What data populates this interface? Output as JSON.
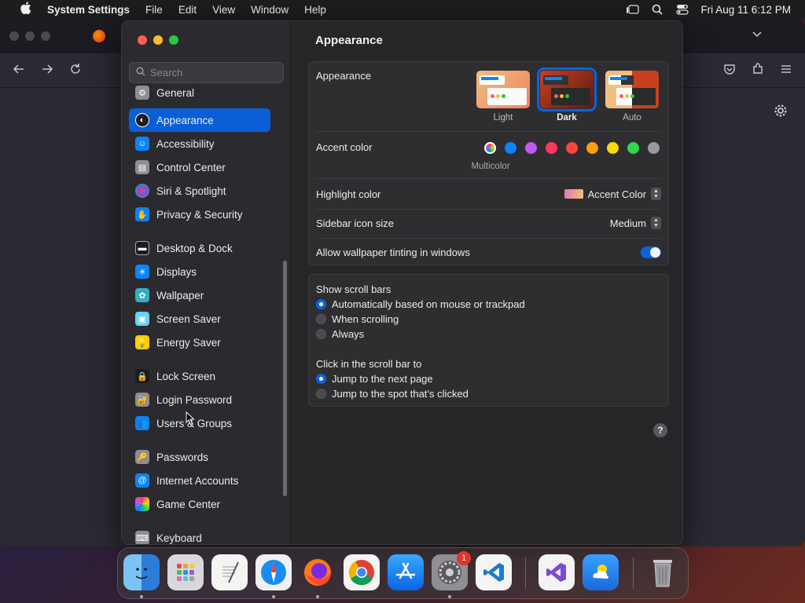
{
  "menubar": {
    "app_name": "System Settings",
    "menus": [
      "File",
      "Edit",
      "View",
      "Window",
      "Help"
    ],
    "datetime": "Fri Aug 11  6:12 PM"
  },
  "sidebar": {
    "search_placeholder": "Search",
    "items": [
      {
        "label": "General",
        "icon": "gear-icon",
        "color": "#8e8e93"
      },
      {
        "label": "Appearance",
        "icon": "appearance-icon",
        "color": "#1c1c1e"
      },
      {
        "label": "Accessibility",
        "icon": "accessibility-icon",
        "color": "#0a84ff"
      },
      {
        "label": "Control Center",
        "icon": "control-center-icon",
        "color": "#8e8e93"
      },
      {
        "label": "Siri & Spotlight",
        "icon": "siri-icon",
        "color": "#bf5af2"
      },
      {
        "label": "Privacy & Security",
        "icon": "hand-icon",
        "color": "#0a84ff"
      },
      {
        "label": "Desktop & Dock",
        "icon": "dock-icon",
        "color": "#1c1c1e"
      },
      {
        "label": "Displays",
        "icon": "sun-icon",
        "color": "#0a84ff"
      },
      {
        "label": "Wallpaper",
        "icon": "flower-icon",
        "color": "#30b0c7"
      },
      {
        "label": "Screen Saver",
        "icon": "screensaver-icon",
        "color": "#64d2ff"
      },
      {
        "label": "Energy Saver",
        "icon": "bulb-icon",
        "color": "#ffcc00"
      },
      {
        "label": "Lock Screen",
        "icon": "lock-icon",
        "color": "#1c1c1e"
      },
      {
        "label": "Login Password",
        "icon": "password-lock-icon",
        "color": "#8e8e93"
      },
      {
        "label": "Users & Groups",
        "icon": "users-icon",
        "color": "#0a84ff"
      },
      {
        "label": "Passwords",
        "icon": "key-icon",
        "color": "#8e8e93"
      },
      {
        "label": "Internet Accounts",
        "icon": "at-icon",
        "color": "#0a84ff"
      },
      {
        "label": "Game Center",
        "icon": "game-center-icon",
        "color": "#ffffff"
      },
      {
        "label": "Keyboard",
        "icon": "keyboard-icon",
        "color": "#8e8e93"
      }
    ]
  },
  "main": {
    "title": "Appearance",
    "appearance": {
      "label": "Appearance",
      "options": [
        {
          "label": "Light",
          "selected": false
        },
        {
          "label": "Dark",
          "selected": true
        },
        {
          "label": "Auto",
          "selected": false
        }
      ]
    },
    "accent": {
      "label": "Accent color",
      "selected_caption": "Multicolor",
      "colors": [
        "multicolor",
        "#0a84ff",
        "#bf5af2",
        "#ff375f",
        "#ff453a",
        "#ff9f0a",
        "#ffd60a",
        "#32d74b",
        "#98989d"
      ]
    },
    "highlight": {
      "label": "Highlight color",
      "value": "Accent Color"
    },
    "sidebar_icon_size": {
      "label": "Sidebar icon size",
      "value": "Medium"
    },
    "wallpaper_tinting": {
      "label": "Allow wallpaper tinting in windows",
      "enabled": true
    },
    "scroll_bars": {
      "label": "Show scroll bars",
      "options": [
        {
          "label": "Automatically based on mouse or trackpad",
          "selected": true
        },
        {
          "label": "When scrolling",
          "selected": false
        },
        {
          "label": "Always",
          "selected": false
        }
      ]
    },
    "click_scroll": {
      "label": "Click in the scroll bar to",
      "options": [
        {
          "label": "Jump to the next page",
          "selected": true
        },
        {
          "label": "Jump to the spot that’s clicked",
          "selected": false
        }
      ]
    },
    "help": "?"
  },
  "dock": {
    "apps": [
      "Finder",
      "Launchpad",
      "TextEdit",
      "Safari",
      "Firefox",
      "Chrome",
      "App Store",
      "System Settings",
      "Visual Studio Code",
      "Visual Studio",
      "Weather",
      "Trash"
    ],
    "settings_badge": "1"
  }
}
